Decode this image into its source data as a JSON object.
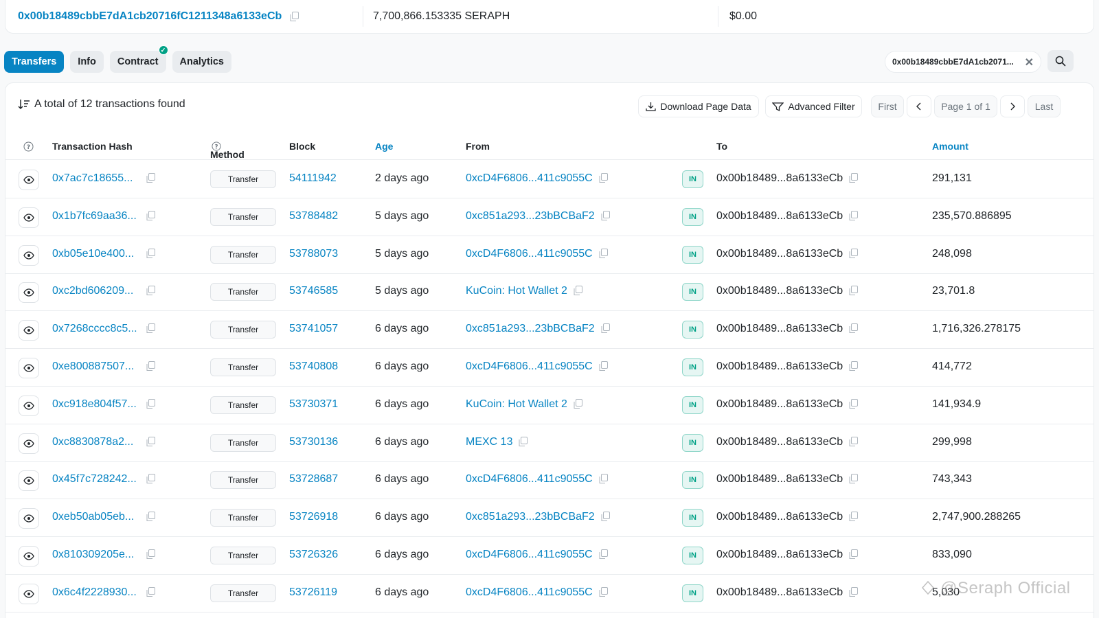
{
  "summary_card": {
    "address": "0x00b18489cbbE7dA1cb20716fC1211348a6133eCb",
    "balance": "7,700,866.153335 SERAPH",
    "value": "$0.00"
  },
  "tabs": [
    {
      "label": "Transfers",
      "active": true
    },
    {
      "label": "Info",
      "active": false
    },
    {
      "label": "Contract",
      "active": false,
      "verified": true
    },
    {
      "label": "Analytics",
      "active": false
    }
  ],
  "filter_chip": {
    "text": "0x00b18489cbbE7dA1cb2071..."
  },
  "toolbar": {
    "summary": "A total of 12 transactions found",
    "download_label": "Download Page Data",
    "advanced_filter_label": "Advanced Filter",
    "first_label": "First",
    "page_label": "Page 1 of 1",
    "last_label": "Last"
  },
  "columns": {
    "hash": "Transaction Hash",
    "method": "Method",
    "block": "Block",
    "age": "Age",
    "from": "From",
    "to": "To",
    "amount": "Amount"
  },
  "rows": [
    {
      "hash": "0x7ac7c18655...",
      "method": "Transfer",
      "block": "54111942",
      "age": "2 days ago",
      "from": "0xcD4F6806...411c9055C",
      "dir": "IN",
      "to": "0x00b18489...8a6133eCb",
      "amount": "291,131"
    },
    {
      "hash": "0x1b7fc69aa36...",
      "method": "Transfer",
      "block": "53788482",
      "age": "5 days ago",
      "from": "0xc851a293...23bBCBaF2",
      "dir": "IN",
      "to": "0x00b18489...8a6133eCb",
      "amount": "235,570.886895"
    },
    {
      "hash": "0xb05e10e400...",
      "method": "Transfer",
      "block": "53788073",
      "age": "5 days ago",
      "from": "0xcD4F6806...411c9055C",
      "dir": "IN",
      "to": "0x00b18489...8a6133eCb",
      "amount": "248,098"
    },
    {
      "hash": "0xc2bd606209...",
      "method": "Transfer",
      "block": "53746585",
      "age": "5 days ago",
      "from": "KuCoin: Hot Wallet 2",
      "dir": "IN",
      "to": "0x00b18489...8a6133eCb",
      "amount": "23,701.8"
    },
    {
      "hash": "0x7268cccc8c5...",
      "method": "Transfer",
      "block": "53741057",
      "age": "6 days ago",
      "from": "0xc851a293...23bBCBaF2",
      "dir": "IN",
      "to": "0x00b18489...8a6133eCb",
      "amount": "1,716,326.278175"
    },
    {
      "hash": "0xe800887507...",
      "method": "Transfer",
      "block": "53740808",
      "age": "6 days ago",
      "from": "0xcD4F6806...411c9055C",
      "dir": "IN",
      "to": "0x00b18489...8a6133eCb",
      "amount": "414,772"
    },
    {
      "hash": "0xc918e804f57...",
      "method": "Transfer",
      "block": "53730371",
      "age": "6 days ago",
      "from": "KuCoin: Hot Wallet 2",
      "dir": "IN",
      "to": "0x00b18489...8a6133eCb",
      "amount": "141,934.9"
    },
    {
      "hash": "0xc8830878a2...",
      "method": "Transfer",
      "block": "53730136",
      "age": "6 days ago",
      "from": "MEXC 13",
      "dir": "IN",
      "to": "0x00b18489...8a6133eCb",
      "amount": "299,998"
    },
    {
      "hash": "0x45f7c728242...",
      "method": "Transfer",
      "block": "53728687",
      "age": "6 days ago",
      "from": "0xcD4F6806...411c9055C",
      "dir": "IN",
      "to": "0x00b18489...8a6133eCb",
      "amount": "743,343"
    },
    {
      "hash": "0xeb50ab05eb...",
      "method": "Transfer",
      "block": "53726918",
      "age": "6 days ago",
      "from": "0xc851a293...23bBCBaF2",
      "dir": "IN",
      "to": "0x00b18489...8a6133eCb",
      "amount": "2,747,900.288265"
    },
    {
      "hash": "0x810309205e...",
      "method": "Transfer",
      "block": "53726326",
      "age": "6 days ago",
      "from": "0xcD4F6806...411c9055C",
      "dir": "IN",
      "to": "0x00b18489...8a6133eCb",
      "amount": "833,090"
    },
    {
      "hash": "0x6c4f2228930...",
      "method": "Transfer",
      "block": "53726119",
      "age": "6 days ago",
      "from": "0xcD4F6806...411c9055C",
      "dir": "IN",
      "to": "0x00b18489...8a6133eCb",
      "amount": "5,030"
    }
  ],
  "watermark": "@Seraph Official",
  "colors": {
    "accent": "#0784c3",
    "success": "#00a186",
    "border": "#e9ecef"
  }
}
